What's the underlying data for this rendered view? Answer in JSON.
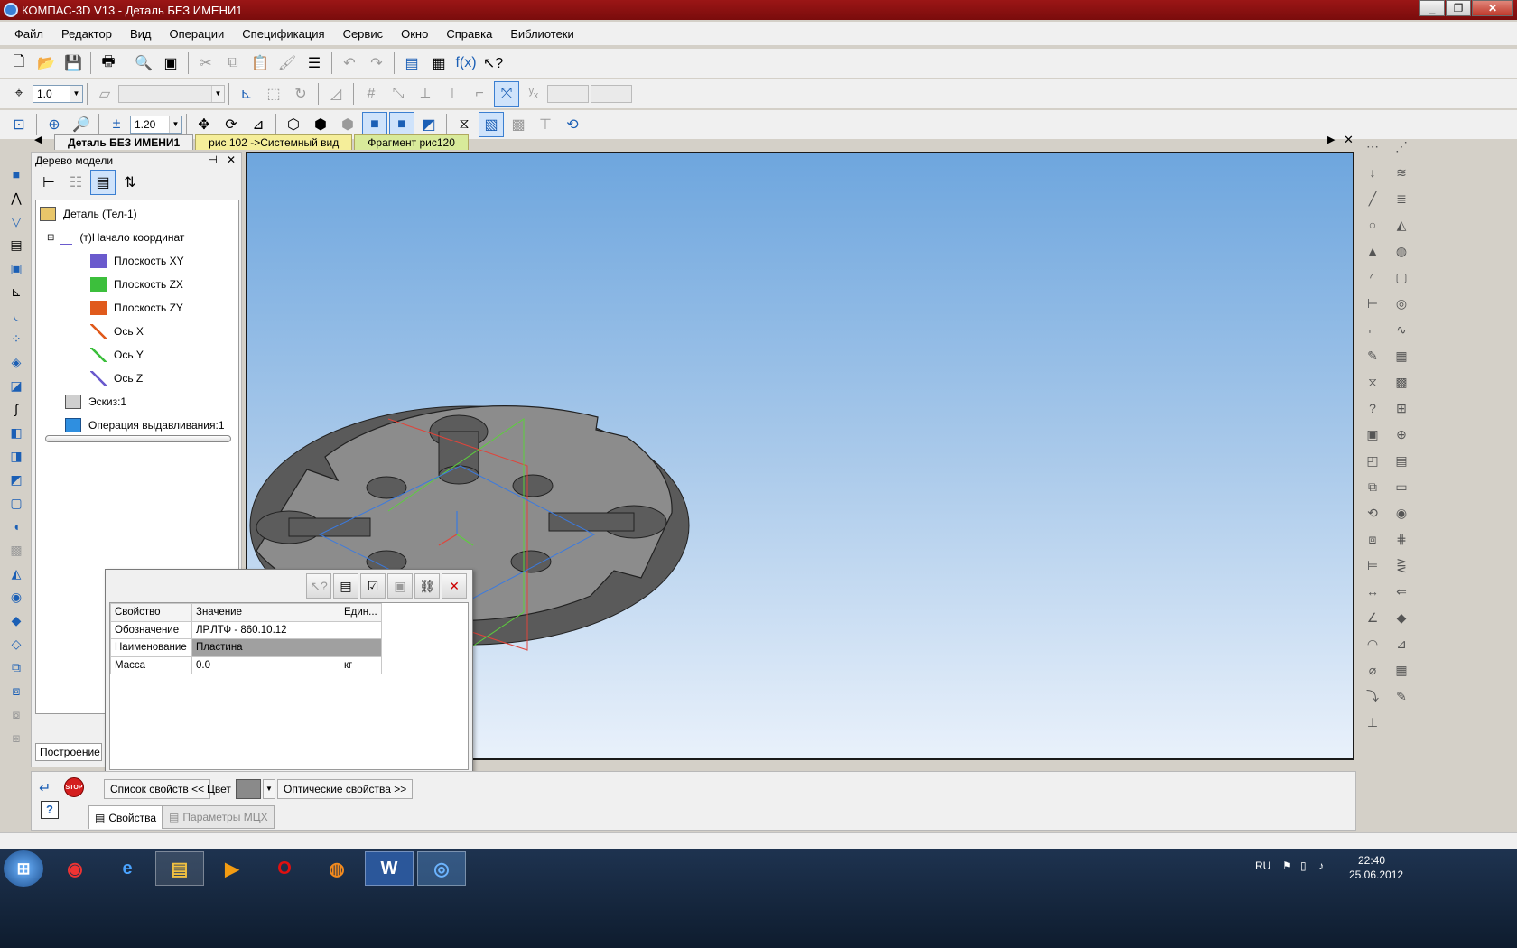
{
  "window": {
    "title": "КОМПАС-3D V13 - Деталь БЕЗ ИМЕНИ1",
    "buttons": [
      "_",
      "❐",
      "✕"
    ]
  },
  "menu": [
    "Файл",
    "Редактор",
    "Вид",
    "Операции",
    "Спецификация",
    "Сервис",
    "Окно",
    "Справка",
    "Библиотеки"
  ],
  "toolbar2": {
    "step_value": "1.0",
    "fx_label": "f(x)"
  },
  "toolbar3": {
    "zoom_value": "1.20"
  },
  "doc_tabs": [
    {
      "label": "Деталь БЕЗ ИМЕНИ1",
      "active": true
    },
    {
      "label": "рис 102 ->Системный вид",
      "active": false
    },
    {
      "label": "Фрагмент рис120",
      "active": false
    }
  ],
  "tree": {
    "title": "Дерево модели",
    "nodes": [
      {
        "label": "Деталь (Тел-1)",
        "icon": "part-icon"
      },
      {
        "label": "(т)Начало координат",
        "icon": "origin-icon"
      },
      {
        "label": "Плоскость XY",
        "icon": "plane-xy-icon",
        "color": "#6a5acd"
      },
      {
        "label": "Плоскость ZX",
        "icon": "plane-zx-icon",
        "color": "#3cbf3c"
      },
      {
        "label": "Плоскость ZY",
        "icon": "plane-zy-icon",
        "color": "#e05a1c"
      },
      {
        "label": "Ось X",
        "icon": "axis-x-icon",
        "color": "#e05a1c"
      },
      {
        "label": "Ось Y",
        "icon": "axis-y-icon",
        "color": "#3cbf3c"
      },
      {
        "label": "Ось Z",
        "icon": "axis-z-icon",
        "color": "#6a5acd"
      },
      {
        "label": "Эскиз:1",
        "icon": "sketch-icon"
      },
      {
        "label": "Операция выдавливания:1",
        "icon": "extrude-icon"
      }
    ],
    "bottom_tab": "Построение"
  },
  "properties": {
    "headers": [
      "Свойство",
      "Значение",
      "Един..."
    ],
    "rows": [
      {
        "prop": "Обозначение",
        "value": "ЛР.ЛТФ - 860.10.12",
        "unit": ""
      },
      {
        "prop": "Наименование",
        "value": "Пластина",
        "unit": ""
      },
      {
        "prop": "Масса",
        "value": "0.0",
        "unit": "кг"
      }
    ]
  },
  "property_bar": {
    "props_list_btn": "Список свойств   <<",
    "color_label": "Цвет",
    "color_value": "#8a8a8a",
    "optical_btn": "Оптические свойства   >>",
    "stop_label": "STOP",
    "tabs": [
      "Свойства",
      "Параметры МЦХ"
    ]
  },
  "taskbar": {
    "lang": "RU",
    "time": "22:40",
    "date": "25.06.2012"
  }
}
